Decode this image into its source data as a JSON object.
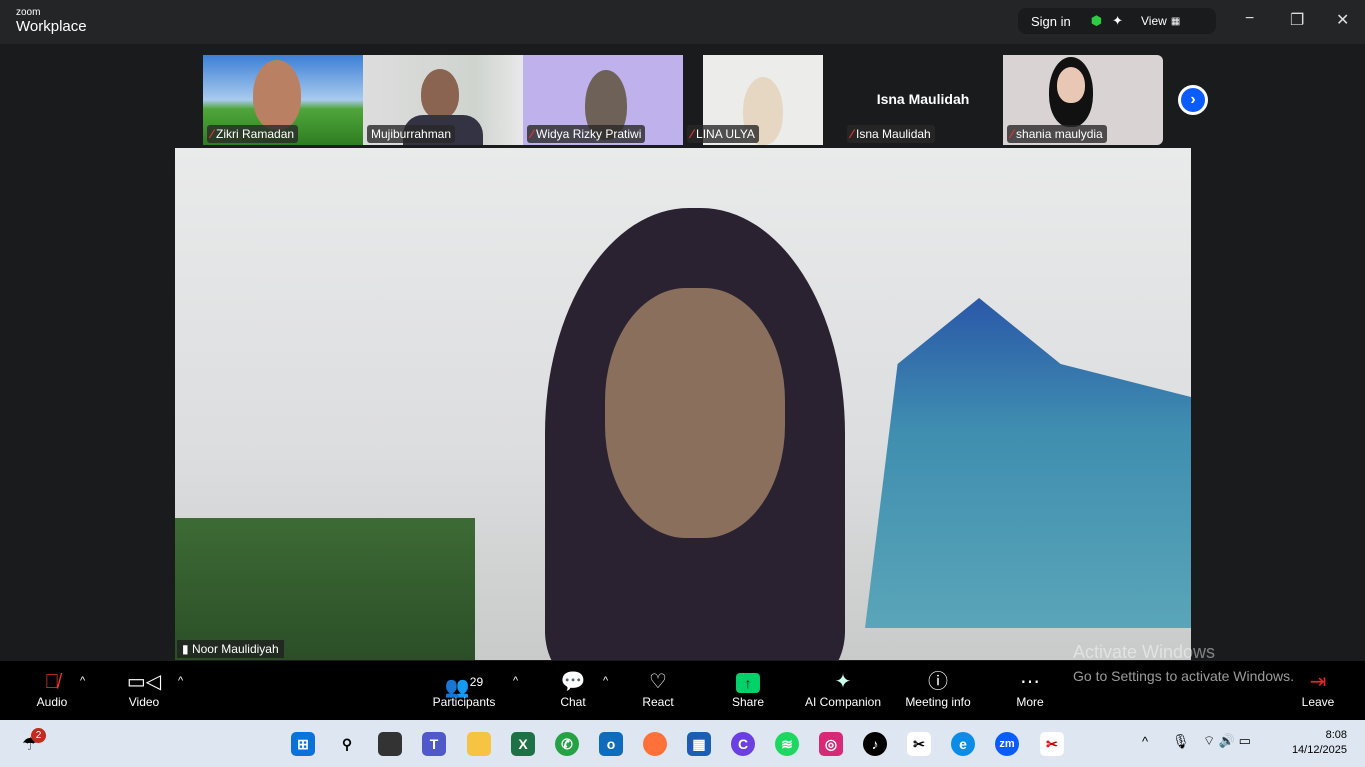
{
  "app": {
    "brand_small": "zoom",
    "brand": "Workplace",
    "sign_in": "Sign in",
    "view": "View"
  },
  "participants": [
    {
      "name": "Zikri Ramadan",
      "muted": true
    },
    {
      "name": "Mujiburrahman",
      "muted": false
    },
    {
      "name": "Widya Rizky Pratiwi",
      "muted": true
    },
    {
      "name": "LINA ULYA",
      "muted": true
    },
    {
      "name": "Isna Maulidah",
      "muted": true,
      "video_off": true
    },
    {
      "name": "shania maulydia",
      "muted": true
    }
  ],
  "speaker": {
    "name": "Noor Maulidiyah"
  },
  "toolbar": {
    "audio": "Audio",
    "video": "Video",
    "participants": "Participants",
    "participant_count": "29",
    "chat": "Chat",
    "react": "React",
    "share": "Share",
    "ai": "AI Companion",
    "info": "Meeting info",
    "more": "More",
    "leave": "Leave"
  },
  "watermark": {
    "title": "Activate Windows",
    "sub": "Go to Settings to activate Windows."
  },
  "taskbar": {
    "weather_badge": "2",
    "time": "8:08",
    "date": "14/12/2025"
  },
  "colors": {
    "accent": "#0b5cff",
    "share": "#00d26a",
    "leave": "#e02828"
  }
}
